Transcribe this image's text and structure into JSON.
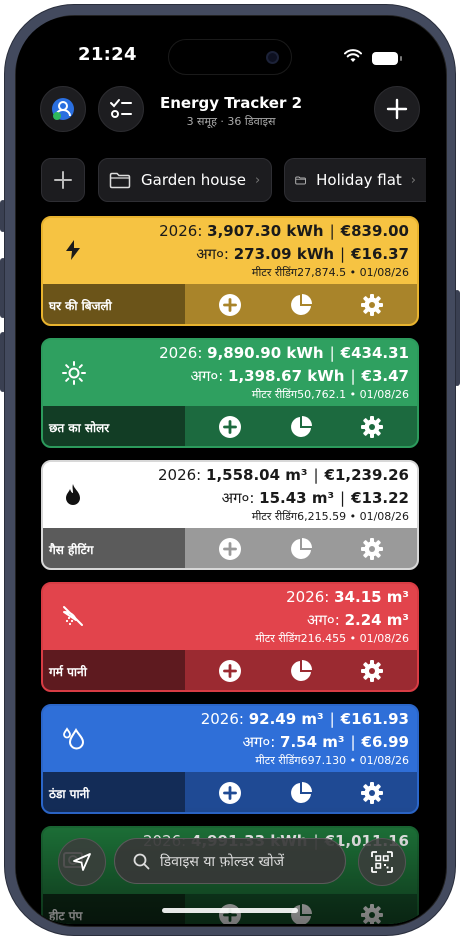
{
  "status": {
    "time": "21:24"
  },
  "header": {
    "title": "Energy Tracker 2",
    "subtitle": "3 समूह · 36 डिवाइस"
  },
  "folders": [
    {
      "label": "Garden house"
    },
    {
      "label": "Holiday flat"
    }
  ],
  "cards": [
    {
      "name": "घर की बिजली",
      "icon": "lightning-icon",
      "year_label": "2026:",
      "year_value": "3,907.30 kWh",
      "year_cost": "€839.00",
      "prev_label": "अग०:",
      "prev_value": "273.09 kWh",
      "prev_cost": "€16.37",
      "reading_label": "मीटर रीडिंग",
      "reading_value": "27,874.5",
      "reading_date": "• 01/08/26",
      "colors": {
        "top": "#f6c342",
        "bottom_left": "#6b5419",
        "bottom_right": "#a9842a",
        "border": "#e8b32e"
      }
    },
    {
      "name": "छत का सोलर",
      "icon": "sun-icon",
      "year_label": "2026:",
      "year_value": "9,890.90 kWh",
      "year_cost": "€434.31",
      "prev_label": "अग०:",
      "prev_value": "1,398.67 kWh",
      "prev_cost": "€3.47",
      "reading_label": "मीटर रीडिंग",
      "reading_value": "50,762.1",
      "reading_date": "• 01/08/26",
      "colors": {
        "top": "#2fa060",
        "bottom_left": "#123d25",
        "bottom_right": "#1c6a3f",
        "border": "#2c9a5c"
      }
    },
    {
      "name": "गैस हीटिंग",
      "icon": "flame-icon",
      "year_label": "2026:",
      "year_value": "1,558.04 m³",
      "year_cost": "€1,239.26",
      "prev_label": "अग०:",
      "prev_value": "15.43 m³",
      "prev_cost": "€13.22",
      "reading_label": "मीटर रीडिंग",
      "reading_value": "6,215.59",
      "reading_date": "• 01/08/26",
      "colors": {
        "top": "#ffffff",
        "bottom_left": "#5b5b5b",
        "bottom_right": "#9a9a9a",
        "border": "#d8d8d8"
      }
    },
    {
      "name": "गर्म पानी",
      "icon": "hot-water-icon",
      "year_label": "2026:",
      "year_value": "34.15 m³",
      "year_cost": "",
      "prev_label": "अग०:",
      "prev_value": "2.24 m³",
      "prev_cost": "",
      "reading_label": "मीटर रीडिंग",
      "reading_value": "216.455",
      "reading_date": "• 01/08/26",
      "colors": {
        "top": "#e2444c",
        "bottom_left": "#5e1a1f",
        "bottom_right": "#9b2a31",
        "border": "#d83c44"
      }
    },
    {
      "name": "ठंडा पानी",
      "icon": "water-drops-icon",
      "year_label": "2026:",
      "year_value": "92.49 m³",
      "year_cost": "€161.93",
      "prev_label": "अग०:",
      "prev_value": "7.54 m³",
      "prev_cost": "€6.99",
      "reading_label": "मीटर रीडिंग",
      "reading_value": "697.130",
      "reading_date": "• 01/08/26",
      "colors": {
        "top": "#2f6fd8",
        "bottom_left": "#132c57",
        "bottom_right": "#1f4a94",
        "border": "#2b66c9"
      }
    },
    {
      "name": "हीट पंप",
      "icon": "heat-pump-icon",
      "year_label": "2026:",
      "year_value": "4,991.33 kWh",
      "year_cost": "€1,011.16",
      "prev_label": "",
      "prev_value": "",
      "prev_cost": "",
      "reading_label": "",
      "reading_value": "",
      "reading_date": "",
      "colors": {
        "top": "#1f7a3c",
        "bottom_left": "#0e2e18",
        "bottom_right": "#15522a",
        "border": "#1c6f37"
      }
    }
  ],
  "search": {
    "placeholder": "डिवाइस या फ़ोल्डर खोजें"
  }
}
